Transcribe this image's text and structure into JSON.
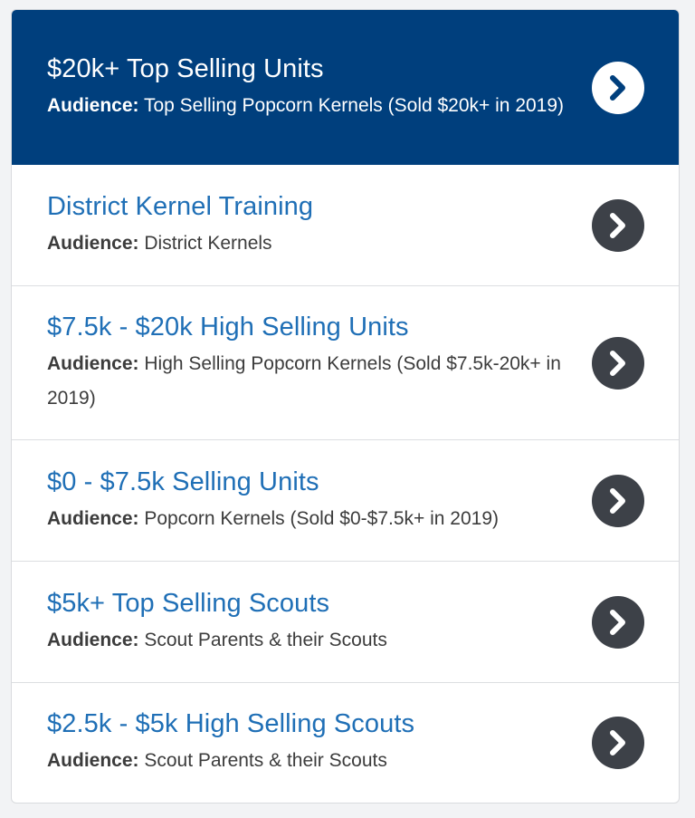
{
  "colors": {
    "active_background": "#003f7d",
    "title_blue": "#1f6fb6",
    "arrow_dark": "#3d4148",
    "text_dark": "#3c3c3c"
  },
  "list": {
    "items": [
      {
        "title": "$20k+ Top Selling Units",
        "audience_label": "Audience:",
        "audience": "Top Selling Popcorn Kernels (Sold $20k+ in 2019)",
        "active": true,
        "icon": "chevron-right-icon"
      },
      {
        "title": "District Kernel Training",
        "audience_label": "Audience:",
        "audience": "District Kernels",
        "active": false,
        "icon": "chevron-right-icon"
      },
      {
        "title": "$7.5k - $20k High Selling Units",
        "audience_label": "Audience:",
        "audience": "High Selling Popcorn Kernels (Sold $7.5k-20k+ in 2019)",
        "active": false,
        "icon": "chevron-right-icon"
      },
      {
        "title": "$0 - $7.5k Selling Units",
        "audience_label": "Audience:",
        "audience": "Popcorn Kernels (Sold $0-$7.5k+ in 2019)",
        "active": false,
        "icon": "chevron-right-icon"
      },
      {
        "title": "$5k+ Top Selling Scouts",
        "audience_label": "Audience:",
        "audience": "Scout Parents & their Scouts",
        "active": false,
        "icon": "chevron-right-icon"
      },
      {
        "title": "$2.5k - $5k High Selling Scouts",
        "audience_label": "Audience:",
        "audience": "Scout Parents & their Scouts",
        "active": false,
        "icon": "chevron-right-icon"
      }
    ]
  }
}
